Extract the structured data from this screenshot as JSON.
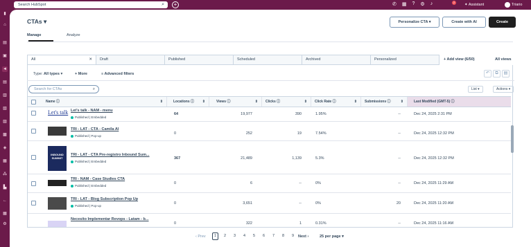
{
  "topbar": {
    "search_placeholder": "Search HubSpot",
    "notification_count": "2",
    "assistant_label": "Assistant",
    "user_name": "Triario"
  },
  "page": {
    "title": "CTAs",
    "title_icon": "caret-down-icon"
  },
  "header_buttons": {
    "personalize": "Personalize CTA",
    "create_ai": "Create with AI",
    "create": "Create"
  },
  "tabs": [
    {
      "label": "Manage",
      "active": true
    },
    {
      "label": "Analyze",
      "active": false
    }
  ],
  "views": [
    {
      "label": "All"
    },
    {
      "label": "Draft"
    },
    {
      "label": "Published"
    },
    {
      "label": "Scheduled"
    },
    {
      "label": "Archived"
    },
    {
      "label": "Personalized"
    }
  ],
  "view_controls": {
    "add_view": "Add view (6/50)",
    "all_views": "All views"
  },
  "filter_bar": {
    "type_label": "Type:",
    "type_value": "All types",
    "more": "More",
    "advanced": "Advanced filters"
  },
  "table_controls": {
    "search_placeholder": "Search for CTAs",
    "list_label": "List",
    "actions_label": "Actions"
  },
  "columns": [
    "Name",
    "Locations",
    "Views",
    "Clicks",
    "Click Rate",
    "Submissions",
    "Last Modified (GMT-5)"
  ],
  "rows": [
    {
      "thumb_text": "Let's talk",
      "name": "Let's talk - NAM - menu",
      "status": "Published | Embedded",
      "locations": "64",
      "views": "19,977",
      "clicks": "390",
      "rate": "1.95%",
      "submissions": "--",
      "modified": "Dec 24, 2025 2:31 PM"
    },
    {
      "thumb_text": "",
      "name": "TRI - LAT - CTA - Camila AI",
      "status": "Published | Pop-up",
      "locations": "0",
      "views": "252",
      "clicks": "19",
      "rate": "7.54%",
      "submissions": "--",
      "modified": "Dec 24, 2025 12:32 PM"
    },
    {
      "thumb_text": "INBOUND SUMMIT",
      "name": "TRI - LAT - CTA Pre-registro Inbound Sum...",
      "status": "Published | Embedded",
      "locations": "367",
      "views": "21,489",
      "clicks": "1,139",
      "rate": "5.3%",
      "submissions": "--",
      "modified": "Dec 24, 2025 12:32 PM"
    },
    {
      "thumb_text": "",
      "name": "TRI - NAM - Case Studies CTA",
      "status": "Published | Embedded",
      "locations": "0",
      "views": "6",
      "clicks": "--",
      "rate": "0%",
      "submissions": "--",
      "modified": "Dec 24, 2025 11:29 AM"
    },
    {
      "thumb_text": "",
      "name": "TRI - LAT - Blog Subscription Pop Up",
      "status": "Published | Pop-up",
      "locations": "0",
      "views": "3,651",
      "clicks": "--",
      "rate": "0%",
      "submissions": "20",
      "modified": "Dec 24, 2025 11:20 AM"
    },
    {
      "thumb_text": "",
      "name": "Necesito Implementar Revops - Latam - b...",
      "status": "",
      "locations": "0",
      "views": "322",
      "clicks": "1",
      "rate": "0.31%",
      "submissions": "--",
      "modified": "Dec 24, 2025 11:16 AM"
    }
  ],
  "pagination": {
    "prev": "Prev",
    "pages": [
      "1",
      "2",
      "3",
      "4",
      "5",
      "6",
      "7",
      "8",
      "9"
    ],
    "current": "1",
    "next": "Next",
    "per_page": "25 per page"
  }
}
